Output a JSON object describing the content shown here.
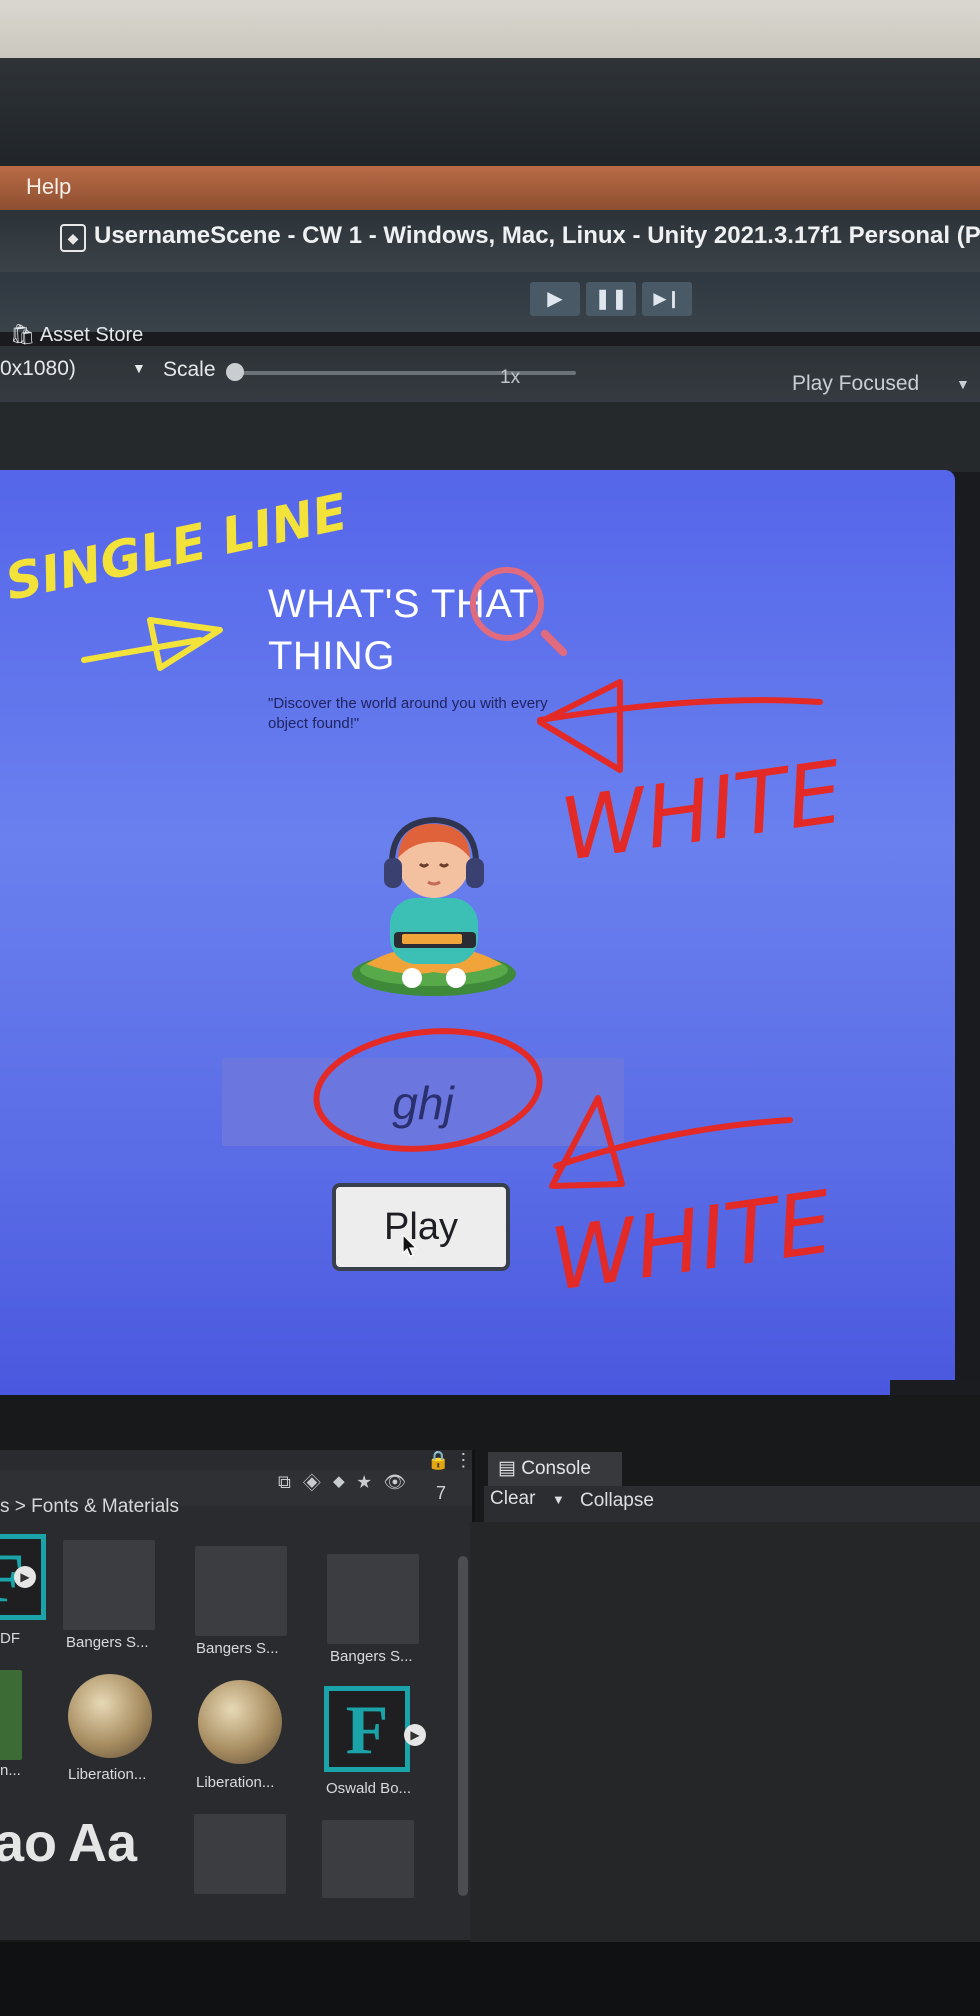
{
  "menubar": {
    "help": "Help"
  },
  "window": {
    "title": "UsernameScene - CW 1 - Windows, Mac, Linux - Unity 2021.3.17f1 Personal (P"
  },
  "toolbar": {
    "play": "▶",
    "pause": "❚❚",
    "step": "▶❙",
    "asset_store": "Asset Store"
  },
  "game_bar": {
    "resolution": "0x1080)",
    "scale_label": "Scale",
    "scale_value": "1x",
    "play_focused": "Play Focused"
  },
  "game": {
    "title_line1": "WHAT'S THAT",
    "title_line2": "THING",
    "tagline": "\"Discover the world around you with every object found!\"",
    "username_value": "ghj",
    "play_button": "Play"
  },
  "project": {
    "breadcrumb": "s > Fonts & Materials",
    "hidden_count": "7",
    "items_row1": [
      "DF",
      "Bangers S...",
      "Bangers S...",
      "Bangers S..."
    ],
    "items_row2": [
      "n...",
      "Liberation...",
      "Liberation...",
      "Oswald Bo..."
    ]
  },
  "console": {
    "tab": "Console",
    "clear": "Clear",
    "collapse": "Collapse"
  },
  "annotations": {
    "single_line": "SINGLE LINE",
    "white_1": "WHITE",
    "white_2": "WHITE"
  },
  "colors": {
    "game_bg": "#5a6ce6",
    "annotation_yellow": "#f2e23a",
    "annotation_red": "#e32a26"
  }
}
